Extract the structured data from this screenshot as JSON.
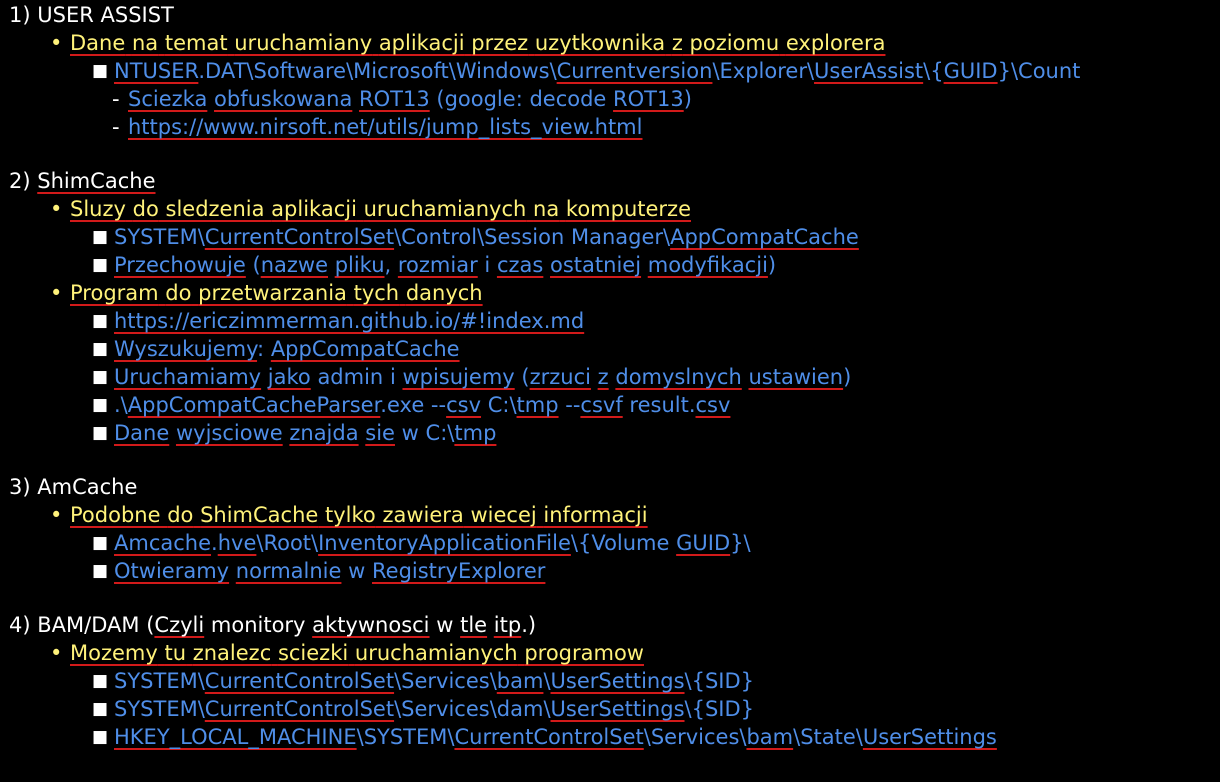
{
  "colors": {
    "background": "#000000",
    "heading": "#ffffff",
    "level1_text": "#fff27a",
    "level2_text": "#4f8ee8",
    "spellcheck_underline": "#d21a1a"
  },
  "sections": [
    {
      "heading": "1) USER ASSIST",
      "items": [
        {
          "text": "Dane na temat uruchamiany aplikacji przez uzytkownika z poziomu explorera",
          "subitems": [
            {
              "text": "NTUSER.DAT\\Software\\Microsoft\\Windows\\Currentversion\\Explorer\\UserAssist\\{GUID}\\Count"
            }
          ],
          "notes": [
            "Sciezka obfuskowana ROT13 (google: decode ROT13)",
            "https://www.nirsoft.net/utils/jump_lists_view.html"
          ]
        }
      ]
    },
    {
      "heading": "2) ShimCache",
      "items": [
        {
          "text": "Sluzy do sledzenia aplikacji uruchamianych na komputerze",
          "subitems": [
            {
              "text": "SYSTEM\\CurrentControlSet\\Control\\Session Manager\\AppCompatCache"
            },
            {
              "text": "Przechowuje (nazwe pliku, rozmiar i czas ostatniej modyfikacji)"
            }
          ]
        },
        {
          "text": "Program do przetwarzania tych danych",
          "subitems": [
            {
              "text": "https://ericzimmerman.github.io/#!index.md"
            },
            {
              "text": "Wyszukujemy: AppCompatCache"
            },
            {
              "text": "Uruchamiamy jako admin i wpisujemy (zrzuci z domyslnych ustawien)"
            },
            {
              "text": ".\\AppCompatCacheParser.exe --csv C:\\tmp --csvf result.csv"
            },
            {
              "text": "Dane wyjsciowe znajda sie w C:\\tmp"
            }
          ]
        }
      ]
    },
    {
      "heading": "3) AmCache",
      "items": [
        {
          "text": "Podobne do ShimCache tylko zawiera wiecej informacji",
          "subitems": [
            {
              "text": "Amcache.hve\\Root\\InventoryApplicationFile\\{Volume GUID}\\"
            },
            {
              "text": "Otwieramy normalnie w RegistryExplorer"
            }
          ]
        }
      ]
    },
    {
      "heading": "4) BAM/DAM (Czyli monitory aktywnosci w tle itp.)",
      "items": [
        {
          "text": "Mozemy tu znalezc sciezki uruchamianych programow",
          "subitems": [
            {
              "text": "SYSTEM\\CurrentControlSet\\Services\\bam\\UserSettings\\{SID}"
            },
            {
              "text": "SYSTEM\\CurrentControlSet\\Services\\dam\\UserSettings\\{SID}"
            },
            {
              "text": "HKEY_LOCAL_MACHINE\\SYSTEM\\CurrentControlSet\\Services\\bam\\State\\UserSettings"
            }
          ]
        }
      ]
    }
  ]
}
